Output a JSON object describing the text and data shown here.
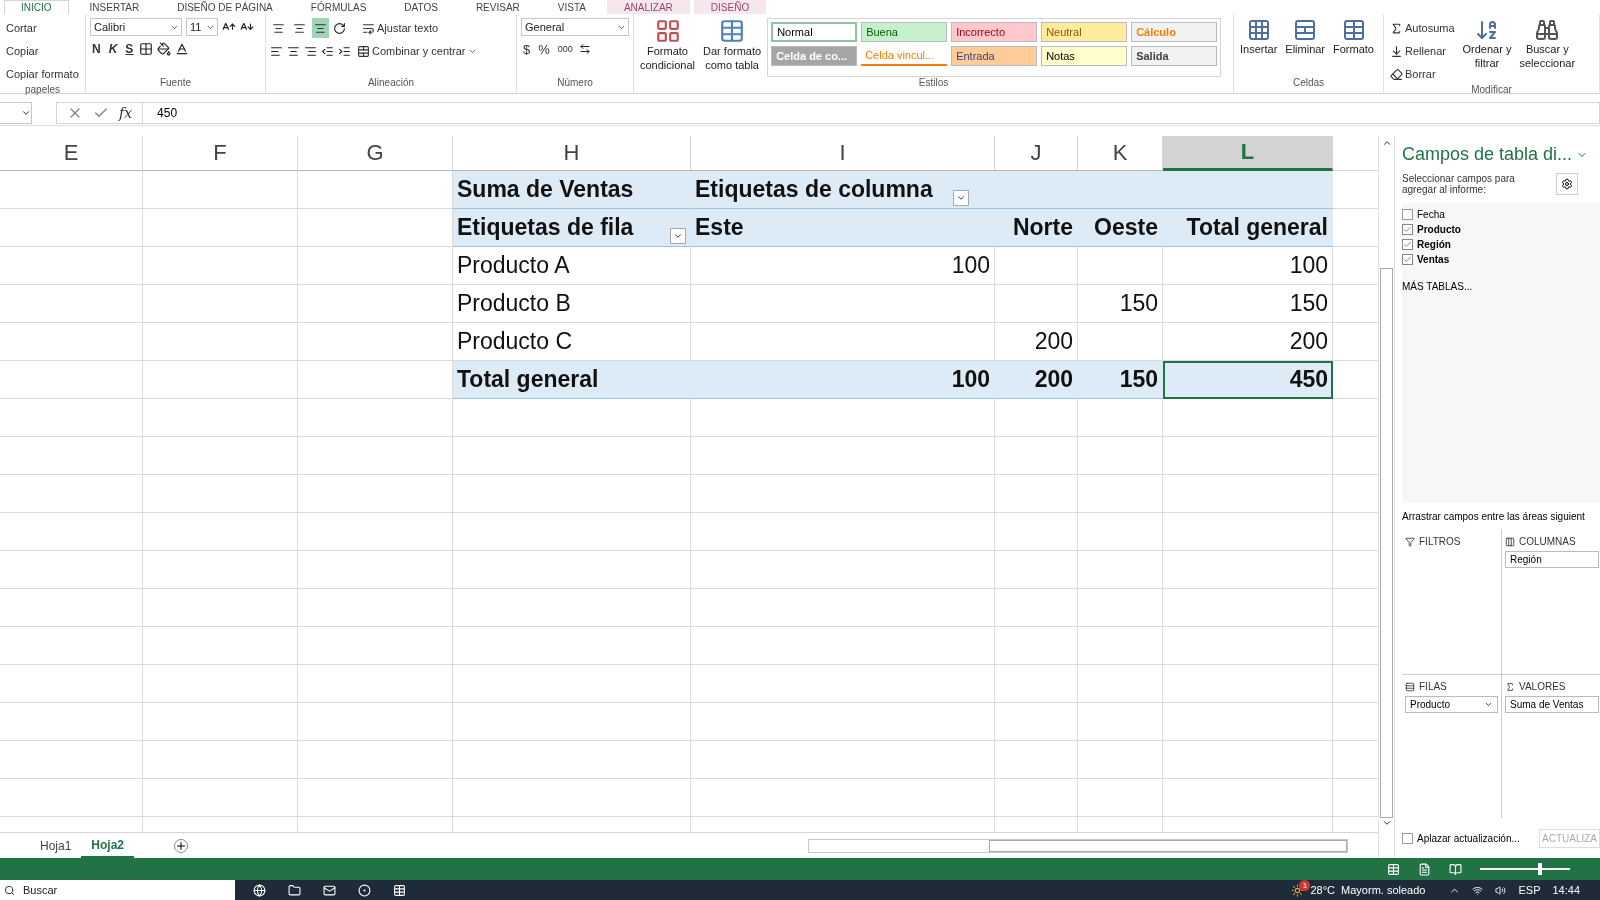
{
  "ribbon_tabs": [
    {
      "label": "INICIO",
      "selected": true,
      "contextual": false
    },
    {
      "label": "INSERTAR",
      "selected": false,
      "contextual": false
    },
    {
      "label": "DISEÑO DE PÁGINA",
      "selected": false,
      "contextual": false
    },
    {
      "label": "FÓRMULAS",
      "selected": false,
      "contextual": false
    },
    {
      "label": "DATOS",
      "selected": false,
      "contextual": false
    },
    {
      "label": "REVISAR",
      "selected": false,
      "contextual": false
    },
    {
      "label": "VISTA",
      "selected": false,
      "contextual": false
    },
    {
      "label": "ANALIZAR",
      "selected": false,
      "contextual": true
    },
    {
      "label": "DISEÑO",
      "selected": false,
      "contextual": true
    }
  ],
  "ribbon": {
    "clipboard": {
      "items": [
        "Cortar",
        "Copiar",
        "Copiar formato"
      ],
      "label": "papeles"
    },
    "font": {
      "family": "Calibri",
      "size": "11",
      "buttons": [
        "N",
        "K",
        "S"
      ],
      "label": "Fuente"
    },
    "alignment": {
      "vertical": [
        {
          "selected": false
        },
        {
          "selected": false
        },
        {
          "selected": true
        }
      ],
      "wrap": "Ajustar texto",
      "merge": "Combinar y centrar",
      "label": "Alineación"
    },
    "number": {
      "format": "General",
      "buttons": [
        "$",
        "%",
        "000"
      ],
      "label": "Número"
    },
    "styles": {
      "conditional": [
        "Formato",
        "condicional"
      ],
      "as_table": [
        "Dar formato",
        "como tabla"
      ],
      "label": "Estilos",
      "gallery": [
        {
          "label": "Normal",
          "kind": "normal",
          "color": "#ffffff",
          "selected": true
        },
        {
          "label": "Buena",
          "kind": "good",
          "color": "#c6efce",
          "selected": false
        },
        {
          "label": "Incorrecto",
          "kind": "bad",
          "color": "#ffc7ce",
          "selected": false
        },
        {
          "label": "Neutral",
          "kind": "neutral",
          "color": "#ffeb9c",
          "selected": false
        },
        {
          "label": "Cálculo",
          "kind": "calculation",
          "color": "#f2f2f2",
          "selected": false
        },
        {
          "label": "Celda de co...",
          "kind": "check",
          "color": "#a5a5a5",
          "selected": false
        },
        {
          "label": "Celda vincul...",
          "kind": "linked",
          "color": "#ffffff",
          "selected": false
        },
        {
          "label": "Entrada",
          "kind": "input",
          "color": "#ffcc99",
          "selected": false
        },
        {
          "label": "Notas",
          "kind": "note",
          "color": "#ffffcc",
          "selected": false
        },
        {
          "label": "Salida",
          "kind": "output",
          "color": "#f2f2f2",
          "selected": false
        }
      ]
    },
    "cells": {
      "buttons": [
        "Insertar",
        "Eliminar",
        "Formato"
      ],
      "label": "Celdas"
    },
    "editing": {
      "autosum": "Autosuma",
      "fill": "Rellenar",
      "clear": "Borrar",
      "sort": [
        "Ordenar y",
        "filtrar"
      ],
      "find": [
        "Buscar y",
        "seleccionar"
      ],
      "label": "Modificar"
    }
  },
  "formula_bar": {
    "function_label": "fx",
    "value": "450"
  },
  "columns": [
    {
      "label": "E",
      "selected": false
    },
    {
      "label": "F",
      "selected": false
    },
    {
      "label": "G",
      "selected": false
    },
    {
      "label": "H",
      "selected": false
    },
    {
      "label": "I",
      "selected": false
    },
    {
      "label": "J",
      "selected": false
    },
    {
      "label": "K",
      "selected": false
    },
    {
      "label": "L",
      "selected": true
    }
  ],
  "pivot": {
    "value_label": "Suma de Ventas",
    "column_labels": "Etiquetas de columna",
    "row_labels": "Etiquetas de fila",
    "column_items": [
      "Este",
      "Norte",
      "Oeste",
      "Total general"
    ],
    "rows": [
      {
        "label": "Producto A",
        "values": [
          {
            "kind": "number",
            "value": "100"
          },
          {
            "kind": "empty"
          },
          {
            "kind": "empty"
          },
          {
            "kind": "number",
            "value": "100"
          }
        ]
      },
      {
        "label": "Producto B",
        "values": [
          {
            "kind": "empty"
          },
          {
            "kind": "empty"
          },
          {
            "kind": "number",
            "value": "150"
          },
          {
            "kind": "number",
            "value": "150"
          }
        ]
      },
      {
        "label": "Producto C",
        "values": [
          {
            "kind": "empty"
          },
          {
            "kind": "number",
            "value": "200"
          },
          {
            "kind": "empty"
          },
          {
            "kind": "number",
            "value": "200"
          }
        ]
      }
    ],
    "total": {
      "label": "Total general",
      "values": [
        {
          "value": "100",
          "selected": false
        },
        {
          "value": "200",
          "selected": false
        },
        {
          "value": "150",
          "selected": false
        },
        {
          "value": "450",
          "selected": true
        }
      ]
    }
  },
  "field_panel": {
    "title": "Campos de tabla di...",
    "subtitle": "Seleccionar campos para agregar al informe:",
    "fields": [
      {
        "label": "Fecha",
        "checked": false
      },
      {
        "label": "Producto",
        "checked": true
      },
      {
        "label": "Región",
        "checked": true
      },
      {
        "label": "Ventas",
        "checked": true
      }
    ],
    "more_tables": "MÁS TABLAS...",
    "drag_hint": "Arrastrar campos entre las áreas siguient",
    "areas": [
      {
        "kind": "filters",
        "title": "FILTROS"
      },
      {
        "kind": "columns",
        "title": "COLUMNAS",
        "items": [
          "Región"
        ]
      },
      {
        "kind": "rows",
        "title": "FILAS",
        "items": [
          "Producto"
        ]
      },
      {
        "kind": "values",
        "title": "VALORES",
        "items": [
          "Suma de Ventas"
        ]
      }
    ],
    "defer": {
      "label": "Aplazar actualización...",
      "checked": false
    },
    "update_button": "ACTUALIZA"
  },
  "sheets": [
    {
      "label": "Hoja1",
      "selected": false
    },
    {
      "label": "Hoja2",
      "selected": true
    }
  ],
  "status_bar": {
    "zoom": {
      "level": 0.67
    }
  },
  "taskbar": {
    "search": "Buscar",
    "weather_badge": "1",
    "weather": "28°C  Mayorm. soleado",
    "language": "ESP",
    "time": "14:44"
  }
}
